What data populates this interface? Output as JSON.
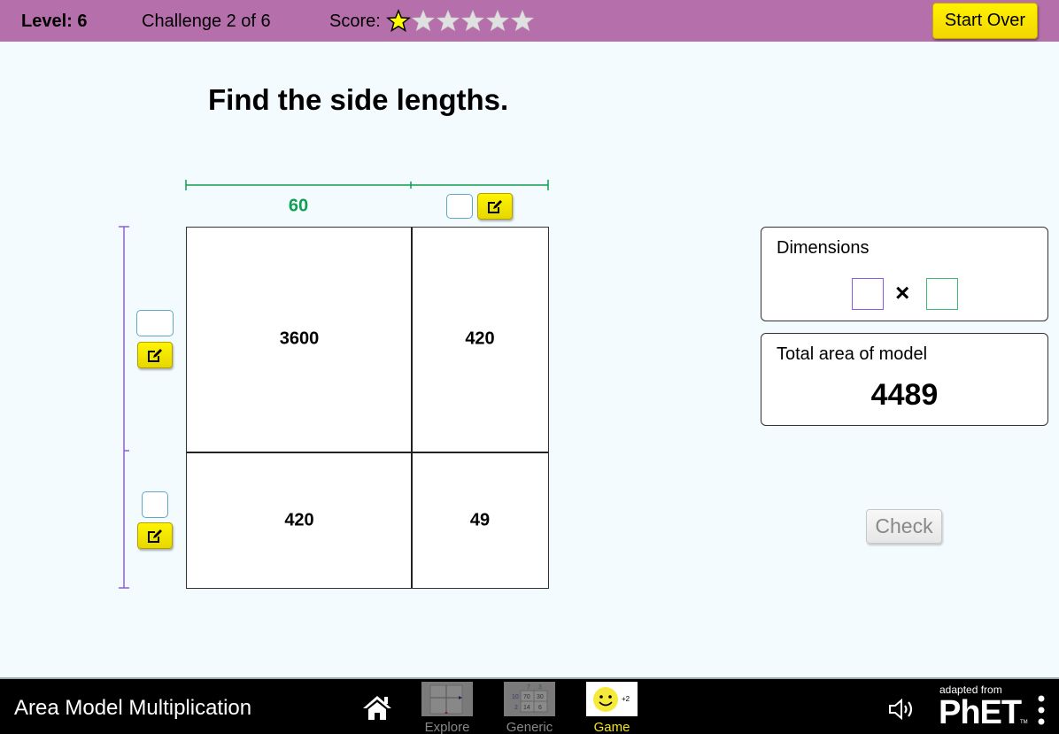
{
  "status_bar": {
    "level_label": "Level: 6",
    "challenge_label": "Challenge 2 of 6",
    "score_label": "Score:",
    "stars_total": 6,
    "stars_filled": 1,
    "start_over_label": "Start Over",
    "colors": {
      "bar": "#b56fab",
      "star_filled": "#ffff00",
      "star_empty": "#e0e0e0"
    }
  },
  "prompt": "Find the side lengths.",
  "area_model": {
    "width_partitions": [
      {
        "value": "60",
        "editable": false
      },
      {
        "value": "",
        "editable": true
      }
    ],
    "height_partitions": [
      {
        "value": "",
        "editable": true
      },
      {
        "value": "",
        "editable": true
      }
    ],
    "cells": [
      [
        "3600",
        "420"
      ],
      [
        "420",
        "49"
      ]
    ],
    "colors": {
      "width": "#10a050",
      "height": "#8c5ce0"
    }
  },
  "dimensions_panel": {
    "title": "Dimensions",
    "height_value": "",
    "width_value": "",
    "times_symbol": "×"
  },
  "area_panel": {
    "title": "Total area of model",
    "value": "4489"
  },
  "check_label": "Check",
  "navbar": {
    "app_title": "Area Model Multiplication",
    "screens": [
      {
        "label": "Explore",
        "active": false
      },
      {
        "label": "Generic",
        "active": false,
        "thumb": {
          "top": [
            "7",
            "3"
          ],
          "left": [
            "10",
            "2"
          ],
          "cells": [
            "70",
            "30",
            "14",
            "6"
          ]
        }
      },
      {
        "label": "Game",
        "active": true,
        "thumb_badge": "+2"
      }
    ],
    "adapted_from": "adapted from",
    "brand": "PhET",
    "trademark": "TM"
  }
}
